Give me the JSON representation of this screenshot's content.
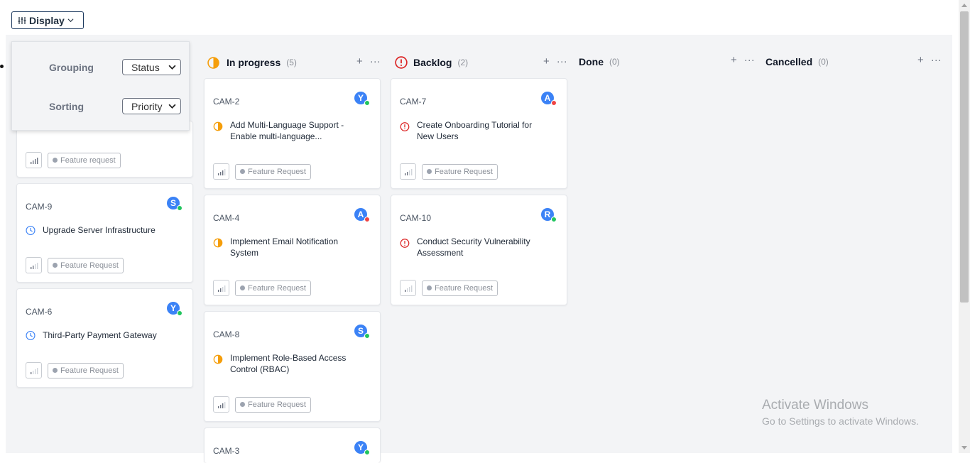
{
  "toolbar": {
    "display_label": "Display"
  },
  "display_menu": {
    "grouping_label": "Grouping",
    "grouping_value": "Status",
    "sorting_label": "Sorting",
    "sorting_value": "Priority"
  },
  "columns": [
    {
      "title": "In progress",
      "count": "(5)",
      "icon": "half-circle-icon"
    },
    {
      "title": "Backlog",
      "count": "(2)",
      "icon": "alert-circle-icon"
    },
    {
      "title": "Done",
      "count": "(0)"
    },
    {
      "title": "Cancelled",
      "count": "(0)"
    }
  ],
  "column_actions": {
    "add": "+",
    "more": "···"
  },
  "todo_cards": [
    {
      "id": "",
      "title": "",
      "tag": "Feature request",
      "priority": 4
    },
    {
      "id": "CAM-9",
      "title": "Upgrade Server Infrastructure",
      "avatar": "S",
      "presence": "online",
      "tag": "Feature Request",
      "priority": 2
    },
    {
      "id": "CAM-6",
      "title": "Third-Party Payment Gateway",
      "avatar": "Y",
      "presence": "online",
      "tag": "Feature Request",
      "priority": 1
    }
  ],
  "progress_cards": [
    {
      "id": "CAM-2",
      "title": "Add Multi-Language Support - Enable multi-language...",
      "avatar": "Y",
      "presence": "online",
      "tag": "Feature Request",
      "priority": 3
    },
    {
      "id": "CAM-4",
      "title": "Implement Email Notification System",
      "avatar": "A",
      "presence": "busy",
      "tag": "Feature Request",
      "priority": 2
    },
    {
      "id": "CAM-8",
      "title": "Implement Role-Based Access Control (RBAC)",
      "avatar": "S",
      "presence": "online",
      "tag": "Feature Request",
      "priority": 3
    },
    {
      "id": "CAM-3",
      "avatar": "Y",
      "presence": "online"
    }
  ],
  "backlog_cards": [
    {
      "id": "CAM-7",
      "title": "Create Onboarding Tutorial for New Users",
      "avatar": "A",
      "presence": "busy",
      "tag": "Feature Request",
      "priority": 2
    },
    {
      "id": "CAM-10",
      "title": "Conduct Security Vulnerability Assessment",
      "avatar": "R",
      "presence": "online",
      "tag": "Feature Request",
      "priority": 1
    }
  ],
  "colors": {
    "online": "#22c55e",
    "busy": "#ef4444",
    "avatar": "#3b82f6",
    "in_progress": "#f59e0b",
    "backlog": "#dc2626",
    "todo": "#3b82f6"
  },
  "watermark": {
    "line1": "Activate Windows",
    "line2": "Go to Settings to activate Windows."
  }
}
